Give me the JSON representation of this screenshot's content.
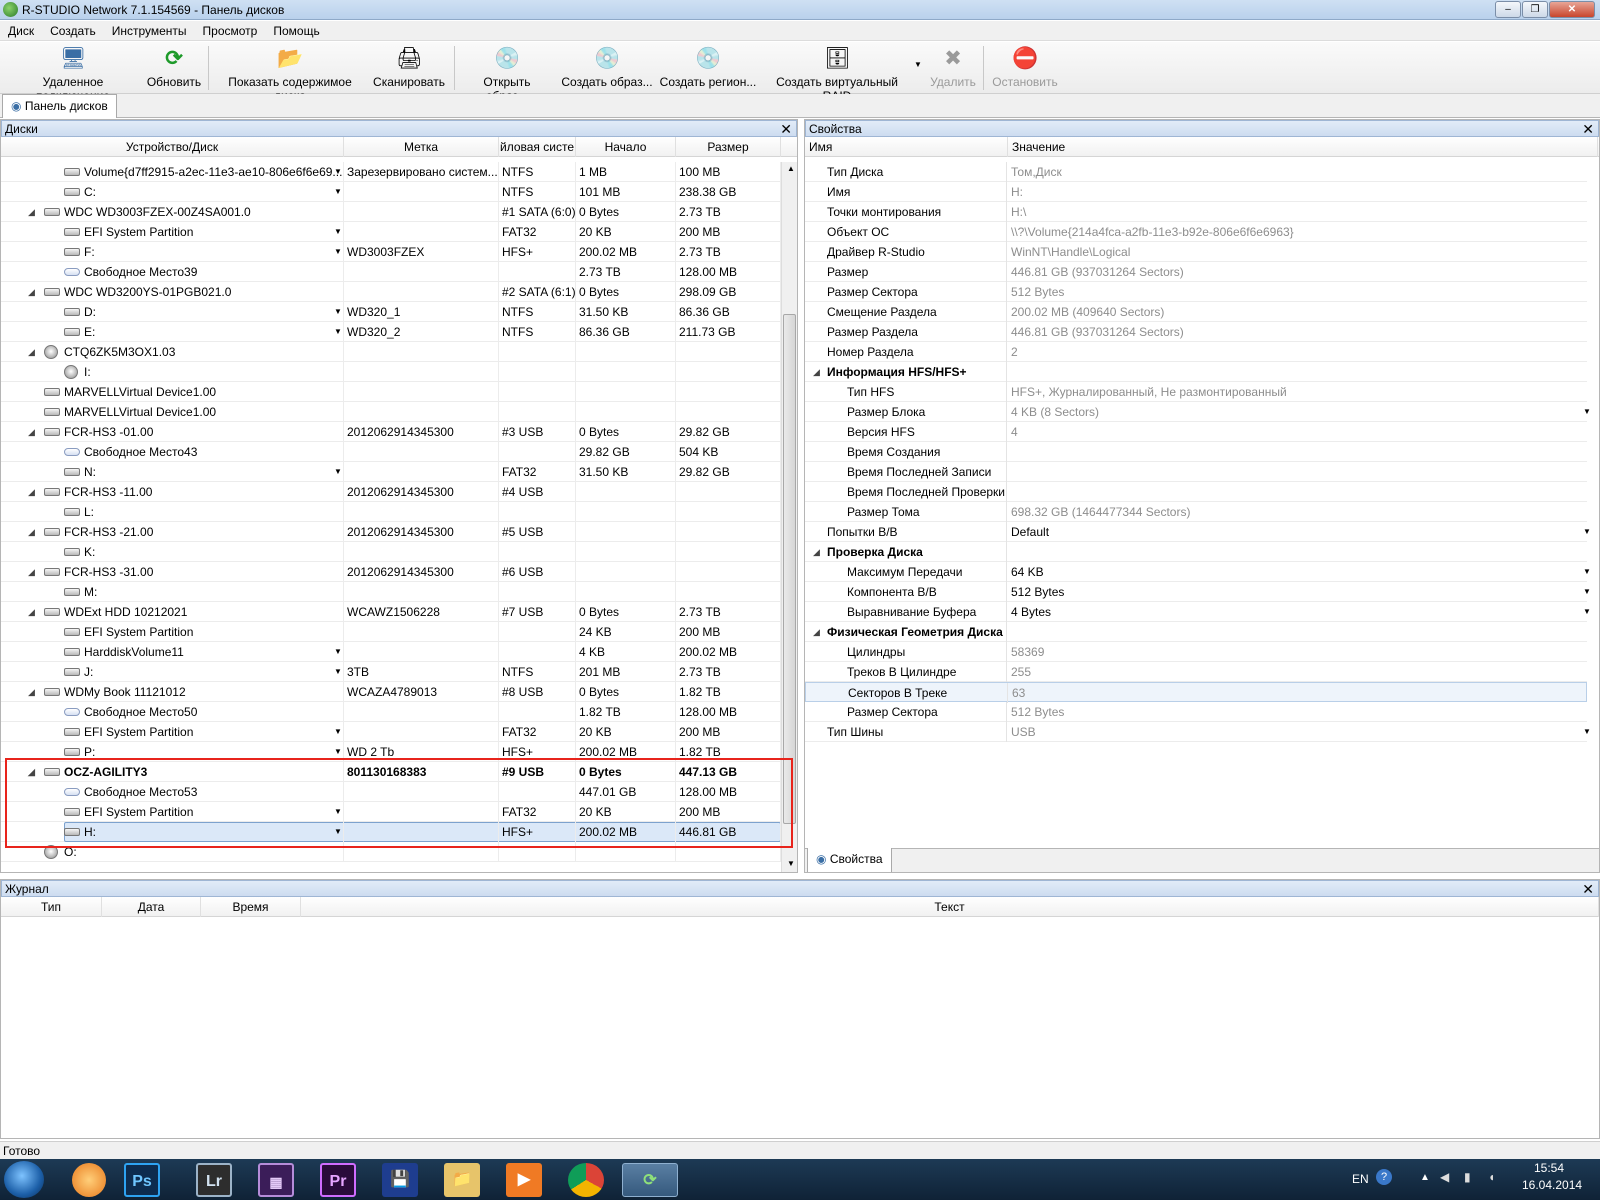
{
  "window": {
    "title": "R-STUDIO Network 7.1.154569 - Панель дисков",
    "min": "–",
    "max": "❐",
    "close": "✕"
  },
  "menu": [
    "Диск",
    "Создать",
    "Инструменты",
    "Просмотр",
    "Помощь"
  ],
  "toolbar": [
    {
      "label": "Удаленное подключение",
      "icon": "computer-icon",
      "glyph": "🖥"
    },
    {
      "label": "Обновить",
      "icon": "refresh-icon",
      "glyph": "⟳"
    },
    {
      "label": "Показать содержимое диска",
      "icon": "folder-tree-icon",
      "glyph": "📂"
    },
    {
      "label": "Сканировать",
      "icon": "scan-icon",
      "glyph": "🖨"
    },
    {
      "label": "Открыть образ...",
      "icon": "open-image-icon",
      "glyph": "💿"
    },
    {
      "label": "Создать образ...",
      "icon": "create-image-icon",
      "glyph": "💿"
    },
    {
      "label": "Создать регион...",
      "icon": "region-icon",
      "glyph": "💿"
    },
    {
      "label": "Создать виртуальный RAID",
      "icon": "raid-icon",
      "glyph": "🗄"
    },
    {
      "label": "Удалить",
      "icon": "delete-icon",
      "glyph": "✖"
    },
    {
      "label": "Остановить",
      "icon": "stop-icon",
      "glyph": "⛔"
    }
  ],
  "tabs": {
    "main": "Панель дисков",
    "props": "Свойства"
  },
  "disks": {
    "title": "Диски",
    "columns": [
      "Устройство/Диск",
      "Метка",
      "йловая систе",
      "Начало",
      "Размер"
    ],
    "rows": [
      {
        "level": 2,
        "name": "Volume{d7ff2915-a2ec-11e3-ae10-806e6f6e69...",
        "label": "Зарезервировано систем...",
        "fs": "NTFS",
        "start": "1 MB",
        "size": "100 MB",
        "dd": true
      },
      {
        "level": 2,
        "name": "C:",
        "label": "",
        "fs": "NTFS",
        "start": "101 MB",
        "size": "238.38 GB",
        "dd": true
      },
      {
        "level": 1,
        "name": "WDC WD3003FZEX-00Z4SA001.0",
        "label": "",
        "fs": "#1 SATA (6:0)",
        "start": "0 Bytes",
        "size": "2.73 TB",
        "exp": true
      },
      {
        "level": 2,
        "name": "EFI System Partition",
        "label": "",
        "fs": "FAT32",
        "start": "20 KB",
        "size": "200 MB",
        "dd": true
      },
      {
        "level": 2,
        "name": "F:",
        "label": "WD3003FZEX",
        "fs": "HFS+",
        "start": "200.02 MB",
        "size": "2.73 TB",
        "dd": true
      },
      {
        "level": 2,
        "name": "Свободное Место39",
        "label": "",
        "fs": "",
        "start": "2.73 TB",
        "size": "128.00 MB",
        "free": true
      },
      {
        "level": 1,
        "name": "WDC WD3200YS-01PGB021.0",
        "label": "",
        "fs": "#2 SATA (6:1)",
        "start": "0 Bytes",
        "size": "298.09 GB",
        "exp": true
      },
      {
        "level": 2,
        "name": "D:",
        "label": "WD320_1",
        "fs": "NTFS",
        "start": "31.50 KB",
        "size": "86.36 GB",
        "dd": true
      },
      {
        "level": 2,
        "name": "E:",
        "label": "WD320_2",
        "fs": "NTFS",
        "start": "86.36 GB",
        "size": "211.73 GB",
        "dd": true
      },
      {
        "level": 1,
        "name": "CTQ6ZK5M3OX1.03",
        "label": "",
        "fs": "",
        "start": "",
        "size": "",
        "exp": true,
        "opt": true
      },
      {
        "level": 2,
        "name": "I:",
        "label": "",
        "fs": "",
        "start": "",
        "size": "",
        "opt": true
      },
      {
        "level": 1,
        "name": "MARVELLVirtual Device1.00",
        "label": "",
        "fs": "",
        "start": "",
        "size": ""
      },
      {
        "level": 1,
        "name": "MARVELLVirtual Device1.00",
        "label": "",
        "fs": "",
        "start": "",
        "size": ""
      },
      {
        "level": 1,
        "name": "FCR-HS3 -01.00",
        "label": "2012062914345300",
        "fs": "#3 USB",
        "start": "0 Bytes",
        "size": "29.82 GB",
        "exp": true
      },
      {
        "level": 2,
        "name": "Свободное Место43",
        "label": "",
        "fs": "",
        "start": "29.82 GB",
        "size": "504 KB",
        "free": true
      },
      {
        "level": 2,
        "name": "N:",
        "label": "",
        "fs": "FAT32",
        "start": "31.50 KB",
        "size": "29.82 GB",
        "dd": true
      },
      {
        "level": 1,
        "name": "FCR-HS3 -11.00",
        "label": "2012062914345300",
        "fs": "#4 USB",
        "start": "",
        "size": "",
        "exp": true
      },
      {
        "level": 2,
        "name": "L:",
        "label": "",
        "fs": "",
        "start": "",
        "size": ""
      },
      {
        "level": 1,
        "name": "FCR-HS3 -21.00",
        "label": "2012062914345300",
        "fs": "#5 USB",
        "start": "",
        "size": "",
        "exp": true
      },
      {
        "level": 2,
        "name": "K:",
        "label": "",
        "fs": "",
        "start": "",
        "size": ""
      },
      {
        "level": 1,
        "name": "FCR-HS3 -31.00",
        "label": "2012062914345300",
        "fs": "#6 USB",
        "start": "",
        "size": "",
        "exp": true
      },
      {
        "level": 2,
        "name": "M:",
        "label": "",
        "fs": "",
        "start": "",
        "size": ""
      },
      {
        "level": 1,
        "name": "WDExt HDD 10212021",
        "label": "WCAWZ1506228",
        "fs": "#7 USB",
        "start": "0 Bytes",
        "size": "2.73 TB",
        "exp": true
      },
      {
        "level": 2,
        "name": "EFI System Partition",
        "label": "",
        "fs": "",
        "start": "24 KB",
        "size": "200 MB"
      },
      {
        "level": 2,
        "name": "HarddiskVolume11",
        "label": "",
        "fs": "",
        "start": "4 KB",
        "size": "200.02 MB",
        "dd": true
      },
      {
        "level": 2,
        "name": "J:",
        "label": "3TB",
        "fs": "NTFS",
        "start": "201 MB",
        "size": "2.73 TB",
        "dd": true
      },
      {
        "level": 1,
        "name": "WDMy Book 11121012",
        "label": "WCAZA4789013",
        "fs": "#8 USB",
        "start": "0 Bytes",
        "size": "1.82 TB",
        "exp": true
      },
      {
        "level": 2,
        "name": "Свободное Место50",
        "label": "",
        "fs": "",
        "start": "1.82 TB",
        "size": "128.00 MB",
        "free": true
      },
      {
        "level": 2,
        "name": "EFI System Partition",
        "label": "",
        "fs": "FAT32",
        "start": "20 KB",
        "size": "200 MB",
        "dd": true
      },
      {
        "level": 2,
        "name": "P:",
        "label": "WD 2 Tb",
        "fs": "HFS+",
        "start": "200.02 MB",
        "size": "1.82 TB",
        "dd": true
      },
      {
        "level": 1,
        "name": "OCZ-AGILITY3",
        "label": "801130168383",
        "fs": "#9 USB",
        "start": "0 Bytes",
        "size": "447.13 GB",
        "exp": true,
        "bold": true
      },
      {
        "level": 2,
        "name": "Свободное Место53",
        "label": "",
        "fs": "",
        "start": "447.01 GB",
        "size": "128.00 MB",
        "free": true
      },
      {
        "level": 2,
        "name": "EFI System Partition",
        "label": "",
        "fs": "FAT32",
        "start": "20 KB",
        "size": "200 MB",
        "dd": true
      },
      {
        "level": 2,
        "name": "H:",
        "label": "",
        "fs": "HFS+",
        "start": "200.02 MB",
        "size": "446.81 GB",
        "dd": true,
        "selected": true
      },
      {
        "level": 1,
        "name": "O:",
        "label": "",
        "fs": "",
        "start": "",
        "size": "",
        "opt": true
      }
    ]
  },
  "props": {
    "title": "Свойства",
    "columns": [
      "Имя",
      "Значение"
    ],
    "rows": [
      {
        "indent": 1,
        "name": "Тип Диска",
        "value": "Том,Диск",
        "grey": true
      },
      {
        "indent": 1,
        "name": "Имя",
        "value": "H:",
        "grey": true
      },
      {
        "indent": 1,
        "name": "Точки монтирования",
        "value": "H:\\",
        "grey": true
      },
      {
        "indent": 1,
        "name": "Объект ОС",
        "value": "\\\\?\\Volume{214a4fca-a2fb-11e3-b92e-806e6f6e6963}",
        "grey": true
      },
      {
        "indent": 1,
        "name": "Драйвер R-Studio",
        "value": "WinNT\\Handle\\Logical",
        "grey": true
      },
      {
        "indent": 1,
        "name": "Размер",
        "value": "446.81 GB (937031264 Sectors)",
        "grey": true
      },
      {
        "indent": 1,
        "name": "Размер Сектора",
        "value": "512 Bytes",
        "grey": true
      },
      {
        "indent": 1,
        "name": "Смещение Раздела",
        "value": "200.02 MB (409640 Sectors)",
        "grey": true
      },
      {
        "indent": 1,
        "name": "Размер Раздела",
        "value": "446.81 GB (937031264 Sectors)",
        "grey": true
      },
      {
        "indent": 1,
        "name": "Номер Раздела",
        "value": "2",
        "grey": true
      },
      {
        "indent": 0,
        "name": "Информация HFS/HFS+",
        "value": "",
        "group": true
      },
      {
        "indent": 2,
        "name": "Тип HFS",
        "value": "HFS+, Журналированный, Не размонтированный",
        "grey": true
      },
      {
        "indent": 2,
        "name": "Размер Блока",
        "value": "4 KB (8 Sectors)",
        "grey": true,
        "dd": true
      },
      {
        "indent": 2,
        "name": "Версия HFS",
        "value": "4",
        "grey": true
      },
      {
        "indent": 2,
        "name": "Время Создания",
        "value": ""
      },
      {
        "indent": 2,
        "name": "Время Последней Записи",
        "value": ""
      },
      {
        "indent": 2,
        "name": "Время Последней Проверки",
        "value": ""
      },
      {
        "indent": 2,
        "name": "Размер Тома",
        "value": "698.32 GB (1464477344 Sectors)",
        "grey": true
      },
      {
        "indent": 1,
        "name": "Попытки В/В",
        "value": "Default",
        "dd": true
      },
      {
        "indent": 0,
        "name": "Проверка Диска",
        "value": "",
        "group": true
      },
      {
        "indent": 2,
        "name": "Максимум Передачи",
        "value": "64 KB",
        "dd": true
      },
      {
        "indent": 2,
        "name": "Компонента В/В",
        "value": "512 Bytes",
        "dd": true
      },
      {
        "indent": 2,
        "name": "Выравнивание Буфера",
        "value": "4 Bytes",
        "dd": true
      },
      {
        "indent": 0,
        "name": "Физическая Геометрия Диска",
        "value": "",
        "group": true
      },
      {
        "indent": 2,
        "name": "Цилиндры",
        "value": "58369",
        "grey": true
      },
      {
        "indent": 2,
        "name": "Треков В Цилиндре",
        "value": "255",
        "grey": true
      },
      {
        "indent": 2,
        "name": "Секторов В Треке",
        "value": "63",
        "grey": true,
        "hl": true
      },
      {
        "indent": 2,
        "name": "Размер Сектора",
        "value": "512 Bytes",
        "grey": true
      },
      {
        "indent": 1,
        "name": "Тип Шины",
        "value": "USB",
        "grey": true,
        "dd": true
      }
    ]
  },
  "journal": {
    "title": "Журнал",
    "columns": [
      "Тип",
      "Дата",
      "Время",
      "Текст"
    ]
  },
  "status": "Готово",
  "taskbar": {
    "lang": "EN",
    "time": "15:54",
    "date": "16.04.2014"
  },
  "colors": {
    "highlight_box": "#e8241c",
    "selected_row": "#dbe8f8",
    "panel_header": "#d6e3f3"
  }
}
